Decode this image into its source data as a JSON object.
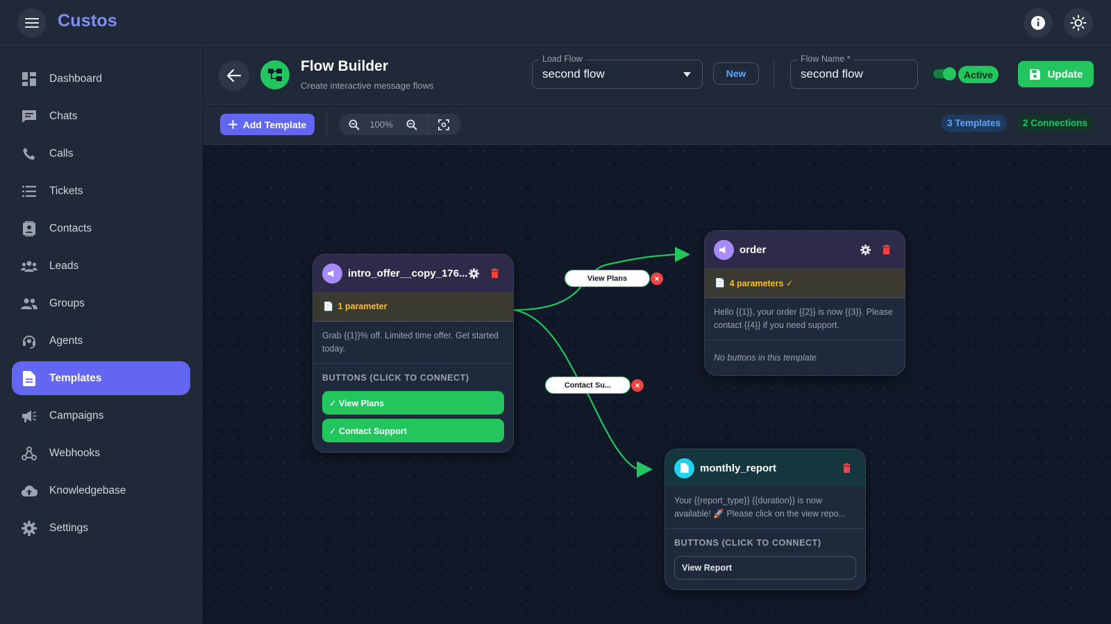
{
  "app": {
    "brand": "Custos"
  },
  "sidebar": {
    "items": [
      {
        "label": "Dashboard",
        "icon": "dashboard-icon"
      },
      {
        "label": "Chats",
        "icon": "chat-icon"
      },
      {
        "label": "Calls",
        "icon": "phone-icon"
      },
      {
        "label": "Tickets",
        "icon": "list-icon"
      },
      {
        "label": "Contacts",
        "icon": "contacts-icon"
      },
      {
        "label": "Leads",
        "icon": "leads-icon"
      },
      {
        "label": "Groups",
        "icon": "groups-icon"
      },
      {
        "label": "Agents",
        "icon": "headset-icon"
      },
      {
        "label": "Templates",
        "icon": "document-icon",
        "active": true
      },
      {
        "label": "Campaigns",
        "icon": "megaphone-icon"
      },
      {
        "label": "Webhooks",
        "icon": "webhook-icon"
      },
      {
        "label": "Knowledgebase",
        "icon": "cloud-upload-icon"
      },
      {
        "label": "Settings",
        "icon": "gear-icon"
      }
    ]
  },
  "header": {
    "title": "Flow Builder",
    "subtitle": "Create interactive message flows",
    "load_flow": {
      "label": "Load Flow",
      "value": "second flow"
    },
    "new_label": "New",
    "flow_name": {
      "label": "Flow Name *",
      "value": "second flow"
    },
    "status_label": "Active",
    "update_label": "Update"
  },
  "toolbar": {
    "add_template_label": "Add Template",
    "zoom": "100%",
    "templates_count": "3 Templates",
    "connections_count": "2 Connections"
  },
  "edges": [
    {
      "label": "View Plans",
      "delete": "×"
    },
    {
      "label": "Contact Su...",
      "delete": "×"
    }
  ],
  "nodes": {
    "intro": {
      "title": "intro_offer__copy_176...",
      "params": "1 parameter",
      "body": "Grab {{1}}% off. Limited time offer. Get started today.",
      "section": "BUTTONS (CLICK TO CONNECT)",
      "buttons": [
        "✓ View Plans",
        "✓ Contact Support"
      ]
    },
    "order": {
      "title": "order",
      "params": "4 parameters ✓",
      "body": "Hello {{1}}, your order {{2}} is now {{3}}. Please contact {{4}} if you need support.",
      "no_buttons": "No buttons in this template"
    },
    "monthly": {
      "title": "monthly_report",
      "body": "Your {{report_type}} {{duration}} is now available! 🚀 Please click on the view repo...",
      "section": "BUTTONS (CLICK TO CONNECT)",
      "buttons": [
        "View Report"
      ]
    }
  },
  "colors": {
    "brand": "#818cf8",
    "primary": "#6366f1",
    "success": "#22c55e",
    "danger": "#ef4444",
    "warning": "#fbbf24",
    "link_blue": "#60a5fa"
  }
}
